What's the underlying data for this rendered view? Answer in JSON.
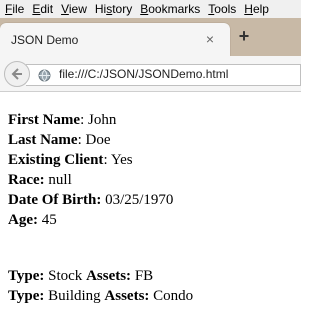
{
  "menu": [
    {
      "ul": "F",
      "rest": "ile"
    },
    {
      "ul": "E",
      "rest": "dit"
    },
    {
      "ul": "V",
      "rest": "iew"
    },
    {
      "ul": "",
      "rest": "Hi",
      "ul2": "s",
      "rest2": "tory"
    },
    {
      "ul": "B",
      "rest": "ookmarks"
    },
    {
      "ul": "T",
      "rest": "ools"
    },
    {
      "ul": "H",
      "rest": "elp"
    }
  ],
  "tab": {
    "title": "JSON Demo",
    "close": "×",
    "new_tab": "+"
  },
  "address": {
    "url": "file:///C:/JSON/JSONDemo.html"
  },
  "person": [
    {
      "label": "First Name",
      "sep": ": ",
      "value": "John",
      "value_bold": false
    },
    {
      "label": "Last Name",
      "sep": ": ",
      "value": "Doe",
      "value_bold": false
    },
    {
      "label": "Existing Client",
      "sep": ": ",
      "value": "Yes",
      "value_bold": false
    },
    {
      "label": "Race:",
      "sep": " ",
      "value": "null",
      "value_bold": false
    },
    {
      "label": "Date Of Birth:",
      "sep": " ",
      "value": "03/25/1970",
      "value_bold": false
    },
    {
      "label": "Age:",
      "sep": " ",
      "value": "45",
      "value_bold": false
    }
  ],
  "assets": [
    {
      "type_label": "Type:",
      "category": "Stock",
      "assets_label": "Assets:",
      "value": "FB"
    },
    {
      "type_label": "Type:",
      "category": "Building",
      "assets_label": "Assets:",
      "value": "Condo"
    }
  ]
}
